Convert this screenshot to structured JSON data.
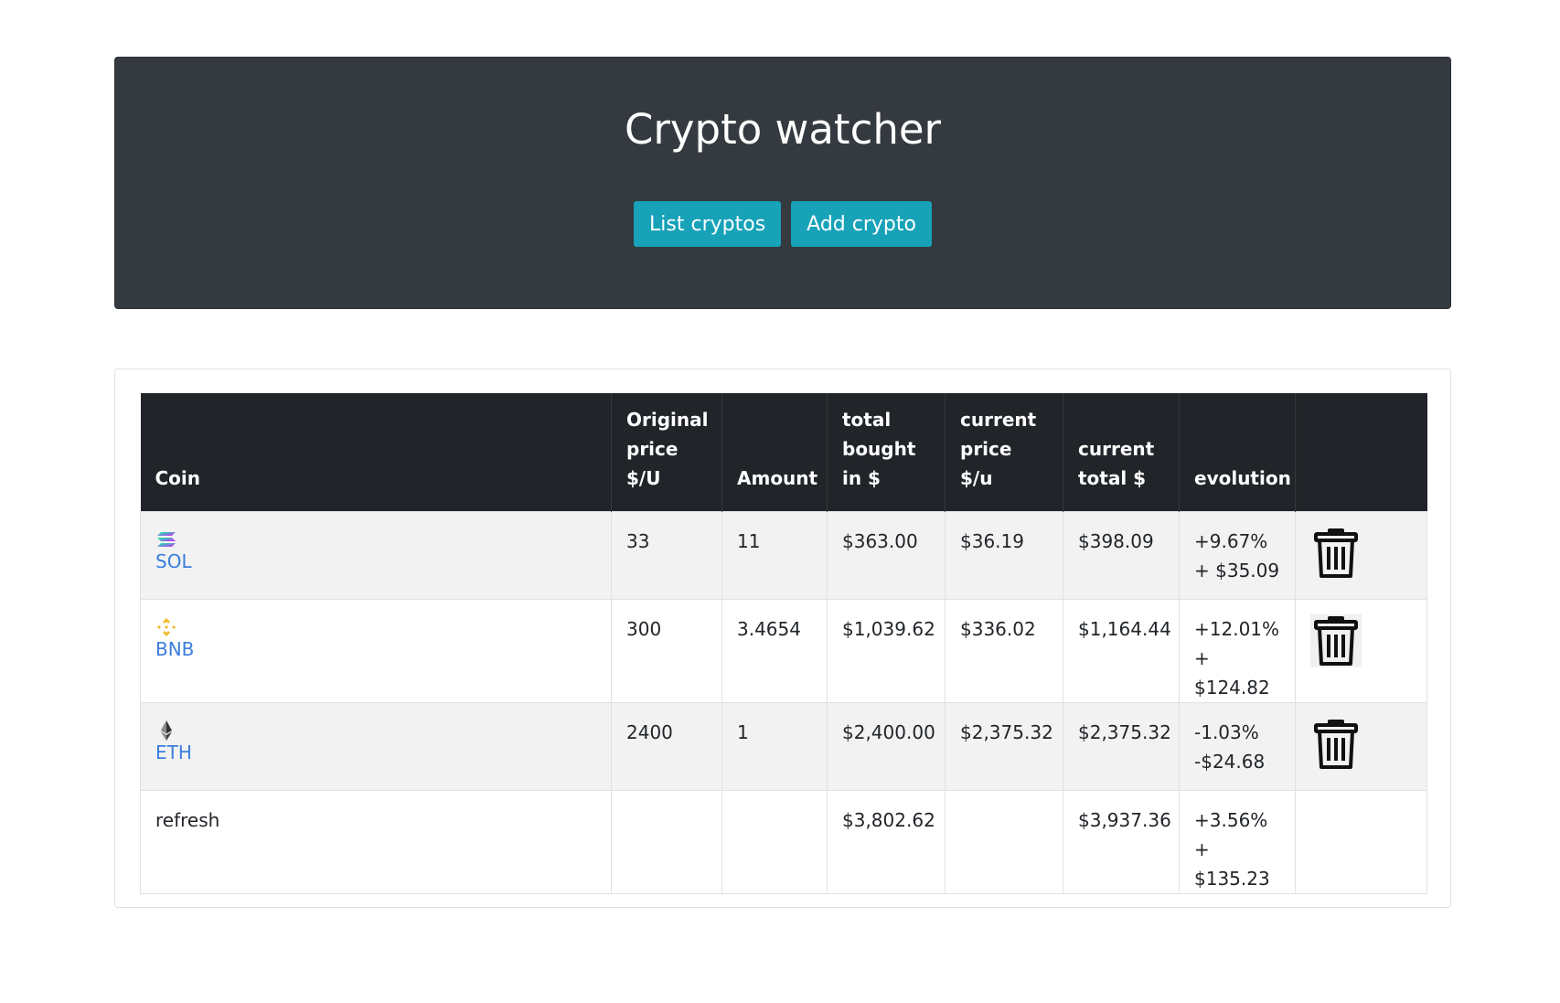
{
  "header": {
    "title": "Crypto watcher",
    "buttons": {
      "list": "List cryptos",
      "add": "Add crypto"
    }
  },
  "table": {
    "columns": {
      "coin": "Coin",
      "original_price": [
        "Original",
        "price",
        "$/U"
      ],
      "amount": "Amount",
      "total_bought": [
        "total",
        "bought",
        "in $"
      ],
      "current_price": [
        "current",
        "price $/u"
      ],
      "current_total": [
        "current",
        "total $"
      ],
      "evolution": "evolution"
    },
    "rows": [
      {
        "coin": "SOL",
        "icon": "solana-icon",
        "original_price": "33",
        "amount": "11",
        "total_bought": "$363.00",
        "current_price": "$36.19",
        "current_total": "$398.09",
        "evolution_pct": "+9.67%",
        "evolution_abs": "+ $35.09",
        "trend": "positive"
      },
      {
        "coin": "BNB",
        "icon": "binance-icon",
        "original_price": "300",
        "amount": "3.4654",
        "total_bought": "$1,039.62",
        "current_price": "$336.02",
        "current_total": "$1,164.44",
        "evolution_pct": "+12.01%",
        "evolution_abs": "+ $124.82",
        "trend": "positive"
      },
      {
        "coin": "ETH",
        "icon": "ethereum-icon",
        "original_price": "2400",
        "amount": "1",
        "total_bought": "$2,400.00",
        "current_price": "$2,375.32",
        "current_total": "$2,375.32",
        "evolution_pct": "-1.03%",
        "evolution_abs": "-$24.68",
        "trend": "negative"
      }
    ],
    "totals": {
      "label": "refresh",
      "total_bought": "$3,802.62",
      "current_total": "$3,937.36",
      "evolution_pct": "+3.56%",
      "evolution_abs": "+ $135.23"
    }
  },
  "colors": {
    "header_bg": "#343a40",
    "button_bg": "#17a2b8",
    "table_head_bg": "#212529",
    "link": "#3b7ddd",
    "positive": "#2f6a31",
    "negative": "#8b2e2e"
  },
  "icons": {
    "delete": "trash-icon"
  }
}
